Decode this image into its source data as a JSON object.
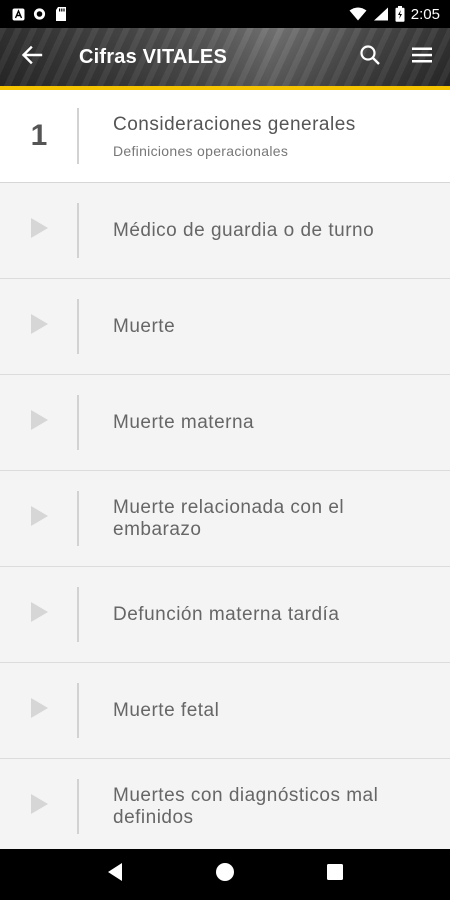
{
  "status_bar": {
    "time": "2:05",
    "icons": [
      "a-notification-icon",
      "circle-notification-icon",
      "sd-card-icon",
      "wifi-icon",
      "signal-icon",
      "battery-icon"
    ]
  },
  "app_bar": {
    "title": "Cifras VITALES",
    "back_icon": "arrow-left-icon",
    "search_icon": "search-icon",
    "menu_icon": "menu-icon"
  },
  "colors": {
    "accent": "#f5c400",
    "status_bar": "#000000",
    "nav_bar": "#000000",
    "list_background": "#f4f4f4",
    "active_row_background": "#ffffff"
  },
  "list": {
    "active": {
      "number": "1",
      "label": "Consideraciones generales",
      "sublabel": "Definiciones operacionales"
    },
    "items": [
      {
        "label": "Médico de guardia o de turno"
      },
      {
        "label": "Muerte"
      },
      {
        "label": "Muerte materna"
      },
      {
        "label": "Muerte relacionada con el embarazo"
      },
      {
        "label": "Defunción materna tardía"
      },
      {
        "label": "Muerte fetal"
      },
      {
        "label": "Muertes con diagnósticos mal definidos"
      }
    ]
  },
  "nav_bar": {
    "back_icon": "triangle-back-icon",
    "home_icon": "circle-home-icon",
    "recents_icon": "square-recents-icon"
  }
}
